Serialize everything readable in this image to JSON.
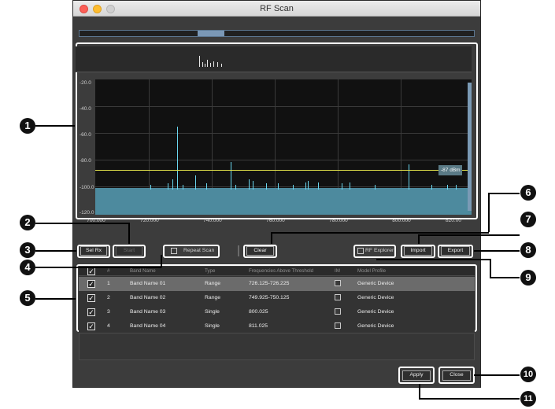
{
  "window": {
    "title": "RF Scan"
  },
  "chart_data": {
    "type": "line",
    "title": "",
    "xlabel": "",
    "ylabel": "",
    "x_ticks": [
      "700.000",
      "720.000",
      "740.000",
      "760.000",
      "780.000",
      "800.000",
      "820.00"
    ],
    "y_ticks": [
      "-20.0",
      "-40.0",
      "-60.0",
      "-80.0",
      "-100.0",
      "-120.0"
    ],
    "xlim": [
      700,
      820
    ],
    "ylim": [
      -120,
      -20
    ],
    "noise_floor": -100,
    "threshold": -87,
    "threshold_label": "-87",
    "threshold_unit": "dBm",
    "peaks": [
      {
        "x": 717.6,
        "y": -98
      },
      {
        "x": 723.0,
        "y": -97
      },
      {
        "x": 724.6,
        "y": -94
      },
      {
        "x": 726.1,
        "y": -55
      },
      {
        "x": 727.8,
        "y": -98
      },
      {
        "x": 732.0,
        "y": -91
      },
      {
        "x": 735.4,
        "y": -97
      },
      {
        "x": 743.2,
        "y": -81
      },
      {
        "x": 744.7,
        "y": -98
      },
      {
        "x": 749.0,
        "y": -94
      },
      {
        "x": 750.2,
        "y": -95
      },
      {
        "x": 754.5,
        "y": -97
      },
      {
        "x": 758.3,
        "y": -97
      },
      {
        "x": 763.0,
        "y": -98
      },
      {
        "x": 767.1,
        "y": -96
      },
      {
        "x": 767.7,
        "y": -95
      },
      {
        "x": 771.1,
        "y": -96
      },
      {
        "x": 778.5,
        "y": -97
      },
      {
        "x": 781.2,
        "y": -96
      },
      {
        "x": 789.2,
        "y": -98
      },
      {
        "x": 800.0,
        "y": -83
      },
      {
        "x": 807.2,
        "y": -98
      },
      {
        "x": 812.3,
        "y": -98
      },
      {
        "x": 815.0,
        "y": -98
      }
    ],
    "grid": true
  },
  "buttons": {
    "sel_rx": "Sel Rx",
    "start": "Start",
    "repeat_scan": "Repeat Scan",
    "clear": "Clear",
    "rf_explorer": "RF Explorer",
    "import": "Import",
    "export": "Export",
    "apply": "Apply",
    "close": "Close"
  },
  "table": {
    "headers": [
      "#",
      "Band Name",
      "Type",
      "Frequencies Above Threshold",
      "IM",
      "Model Profile"
    ],
    "rows": [
      {
        "num": "1",
        "band": "Band Name 01",
        "type": "Range",
        "freq": "726.125-726.225",
        "model": "Generic Device",
        "checked": true
      },
      {
        "num": "2",
        "band": "Band Name 02",
        "type": "Range",
        "freq": "749.925-750.125",
        "model": "Generic Device",
        "checked": true
      },
      {
        "num": "3",
        "band": "Band Name 03",
        "type": "Single",
        "freq": "800.025",
        "model": "Generic Device",
        "checked": true
      },
      {
        "num": "4",
        "band": "Band Name 04",
        "type": "Single",
        "freq": "811.025",
        "model": "Generic Device",
        "checked": true
      }
    ]
  },
  "callouts": [
    "1",
    "2",
    "3",
    "4",
    "5",
    "6",
    "7",
    "8",
    "9",
    "10",
    "11"
  ],
  "colors": {
    "noise_floor": "#4d8a9e",
    "peaks": "#6ad7ef",
    "threshold": "#e3e24a"
  }
}
